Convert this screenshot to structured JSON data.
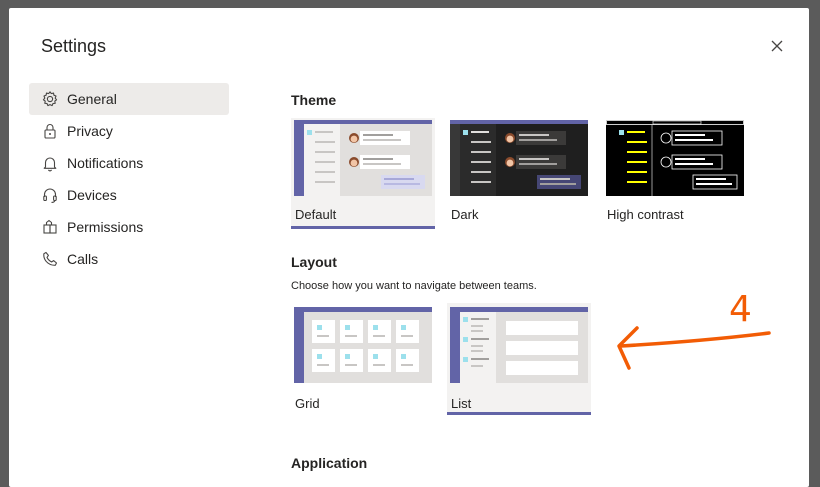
{
  "dialog": {
    "title": "Settings",
    "close_icon": "close-icon"
  },
  "nav": {
    "items": [
      {
        "label": "General",
        "icon": "gear-icon",
        "active": true
      },
      {
        "label": "Privacy",
        "icon": "lock-icon",
        "active": false
      },
      {
        "label": "Notifications",
        "icon": "bell-icon",
        "active": false
      },
      {
        "label": "Devices",
        "icon": "headset-icon",
        "active": false
      },
      {
        "label": "Permissions",
        "icon": "permissions-icon",
        "active": false
      },
      {
        "label": "Calls",
        "icon": "phone-icon",
        "active": false
      }
    ]
  },
  "theme": {
    "title": "Theme",
    "options": [
      {
        "label": "Default",
        "selected": true
      },
      {
        "label": "Dark",
        "selected": false
      },
      {
        "label": "High contrast",
        "selected": false
      }
    ]
  },
  "layout": {
    "title": "Layout",
    "description": "Choose how you want to navigate between teams.",
    "options": [
      {
        "label": "Grid",
        "selected": false
      },
      {
        "label": "List",
        "selected": true
      }
    ]
  },
  "application": {
    "title": "Application"
  },
  "annotation": {
    "text": "4",
    "color": "#f25c05"
  },
  "colors": {
    "accent": "#6264a7",
    "selected_bg": "#f3f2f1"
  }
}
